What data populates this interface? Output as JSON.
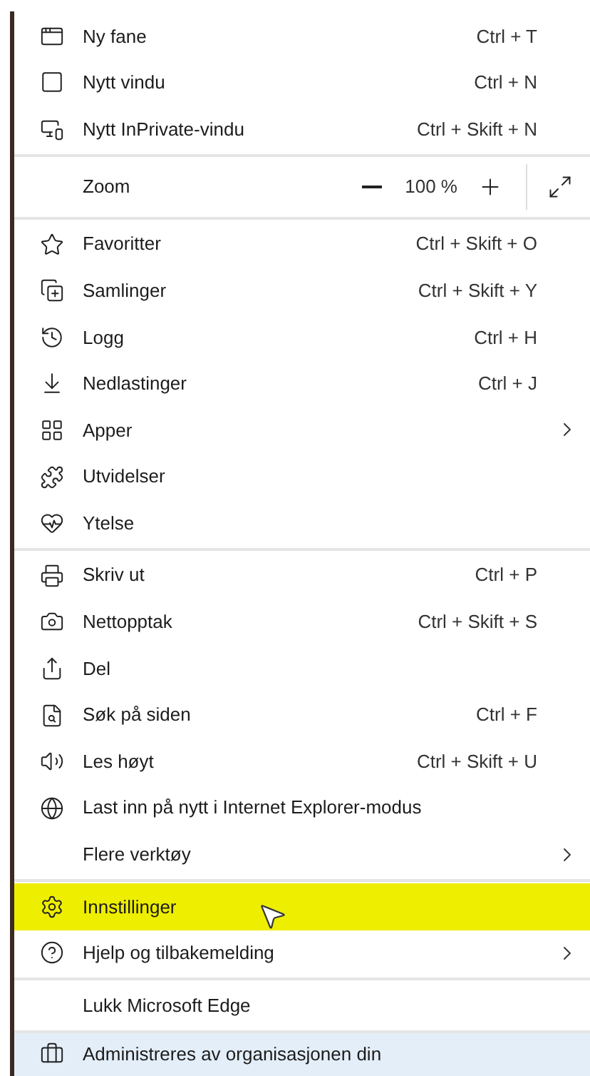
{
  "menu": {
    "sections": [
      {
        "items": [
          {
            "kind": "item",
            "label": "Ny fane",
            "shortcut": "Ctrl + T",
            "submenu": false,
            "highlighted": false
          },
          {
            "kind": "item",
            "label": "Nytt vindu",
            "shortcut": "Ctrl + N",
            "submenu": false,
            "highlighted": false
          },
          {
            "kind": "item",
            "label": "Nytt InPrivate-vindu",
            "shortcut": "Ctrl + Skift + N",
            "submenu": false,
            "highlighted": false
          }
        ]
      },
      {
        "items": [
          {
            "kind": "zoom",
            "label": "Zoom",
            "value": "100 %"
          }
        ]
      },
      {
        "items": [
          {
            "kind": "item",
            "label": "Favoritter",
            "shortcut": "Ctrl + Skift + O",
            "submenu": false,
            "highlighted": false
          },
          {
            "kind": "item",
            "label": "Samlinger",
            "shortcut": "Ctrl + Skift + Y",
            "submenu": false,
            "highlighted": false
          },
          {
            "kind": "item",
            "label": "Logg",
            "shortcut": "Ctrl + H",
            "submenu": false,
            "highlighted": false
          },
          {
            "kind": "item",
            "label": "Nedlastinger",
            "shortcut": "Ctrl + J",
            "submenu": false,
            "highlighted": false
          },
          {
            "kind": "item",
            "label": "Apper",
            "submenu": true,
            "highlighted": false
          },
          {
            "kind": "item",
            "label": "Utvidelser",
            "submenu": false,
            "highlighted": false
          },
          {
            "kind": "item",
            "label": "Ytelse",
            "submenu": false,
            "highlighted": false
          }
        ]
      },
      {
        "items": [
          {
            "kind": "item",
            "label": "Skriv ut",
            "shortcut": "Ctrl + P",
            "submenu": false,
            "highlighted": false
          },
          {
            "kind": "item",
            "label": "Nettopptak",
            "shortcut": "Ctrl + Skift + S",
            "submenu": false,
            "highlighted": false
          },
          {
            "kind": "item",
            "label": "Del",
            "submenu": false,
            "highlighted": false
          },
          {
            "kind": "item",
            "label": "Søk på siden",
            "shortcut": "Ctrl + F",
            "submenu": false,
            "highlighted": false
          },
          {
            "kind": "item",
            "label": "Les høyt",
            "shortcut": "Ctrl + Skift + U",
            "submenu": false,
            "highlighted": false
          },
          {
            "kind": "item",
            "label": "Last inn på nytt i Internet Explorer-modus",
            "submenu": false,
            "highlighted": false
          },
          {
            "kind": "item",
            "label": "Flere verktøy",
            "submenu": true,
            "highlighted": false
          }
        ]
      },
      {
        "items": [
          {
            "kind": "item",
            "label": "Innstillinger",
            "submenu": false,
            "highlighted": true
          },
          {
            "kind": "item",
            "label": "Hjelp og tilbakemelding",
            "submenu": true,
            "highlighted": false
          }
        ]
      },
      {
        "items": [
          {
            "kind": "item",
            "label": "Lukk Microsoft Edge",
            "submenu": false,
            "highlighted": false
          }
        ]
      }
    ],
    "footer": {
      "label": "Administreres av organisasjonen din"
    }
  }
}
